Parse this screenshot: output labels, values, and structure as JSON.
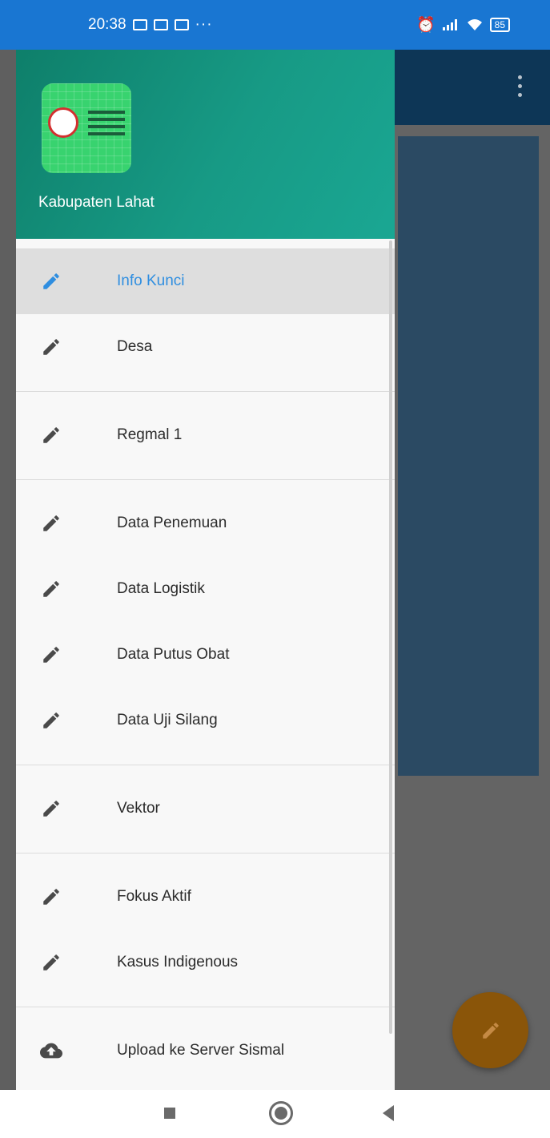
{
  "status_bar": {
    "time": "20:38",
    "more": "···",
    "battery": "85"
  },
  "drawer": {
    "header_title": "Kabupaten Lahat",
    "items": [
      {
        "label": "Info Kunci",
        "icon": "pencil-icon",
        "selected": true
      },
      {
        "label": "Desa",
        "icon": "pencil-icon"
      },
      {
        "label": "Regmal 1",
        "icon": "pencil-icon"
      },
      {
        "label": "Data Penemuan",
        "icon": "pencil-icon"
      },
      {
        "label": "Data Logistik",
        "icon": "pencil-icon"
      },
      {
        "label": "Data Putus Obat",
        "icon": "pencil-icon"
      },
      {
        "label": "Data Uji Silang",
        "icon": "pencil-icon"
      },
      {
        "label": "Vektor",
        "icon": "pencil-icon"
      },
      {
        "label": "Fokus Aktif",
        "icon": "pencil-icon"
      },
      {
        "label": "Kasus Indigenous",
        "icon": "pencil-icon"
      },
      {
        "label": "Upload ke Server Sismal",
        "icon": "cloud-upload-icon"
      }
    ]
  },
  "colors": {
    "status_bar": "#1976d2",
    "header_gradient_start": "#0e7f6a",
    "selected_text": "#2f8ee0",
    "fab": "#8a5509"
  }
}
